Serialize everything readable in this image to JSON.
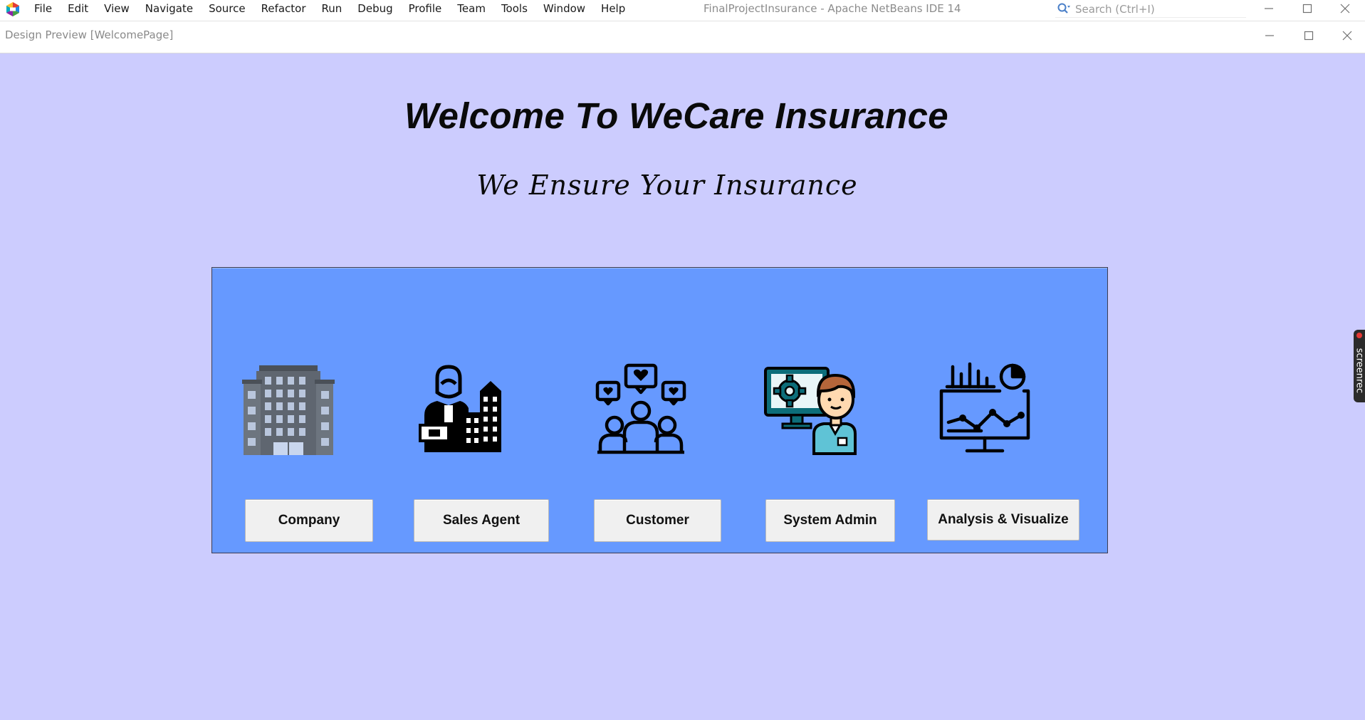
{
  "menubar": {
    "items": [
      "File",
      "Edit",
      "View",
      "Navigate",
      "Source",
      "Refactor",
      "Run",
      "Debug",
      "Profile",
      "Team",
      "Tools",
      "Window",
      "Help"
    ],
    "window_title": "FinalProjectInsurance - Apache NetBeans IDE 14",
    "search_placeholder": "Search (Ctrl+I)"
  },
  "preview": {
    "title": "Design Preview [WelcomePage]"
  },
  "form": {
    "heading": "Welcome To WeCare Insurance",
    "tagline": "We Ensure Your Insurance",
    "background_color": "#ccccfe",
    "panel_color": "#6699ff",
    "roles": [
      {
        "label": "Company",
        "icon": "office-building-icon"
      },
      {
        "label": "Sales Agent",
        "icon": "sales-agent-icon"
      },
      {
        "label": "Customer",
        "icon": "customers-group-icon"
      },
      {
        "label": "System Admin",
        "icon": "system-admin-icon"
      },
      {
        "label": "Analysis & Visualize",
        "icon": "analytics-dashboard-icon"
      }
    ]
  },
  "overlay": {
    "badge_text": "screenrec"
  }
}
